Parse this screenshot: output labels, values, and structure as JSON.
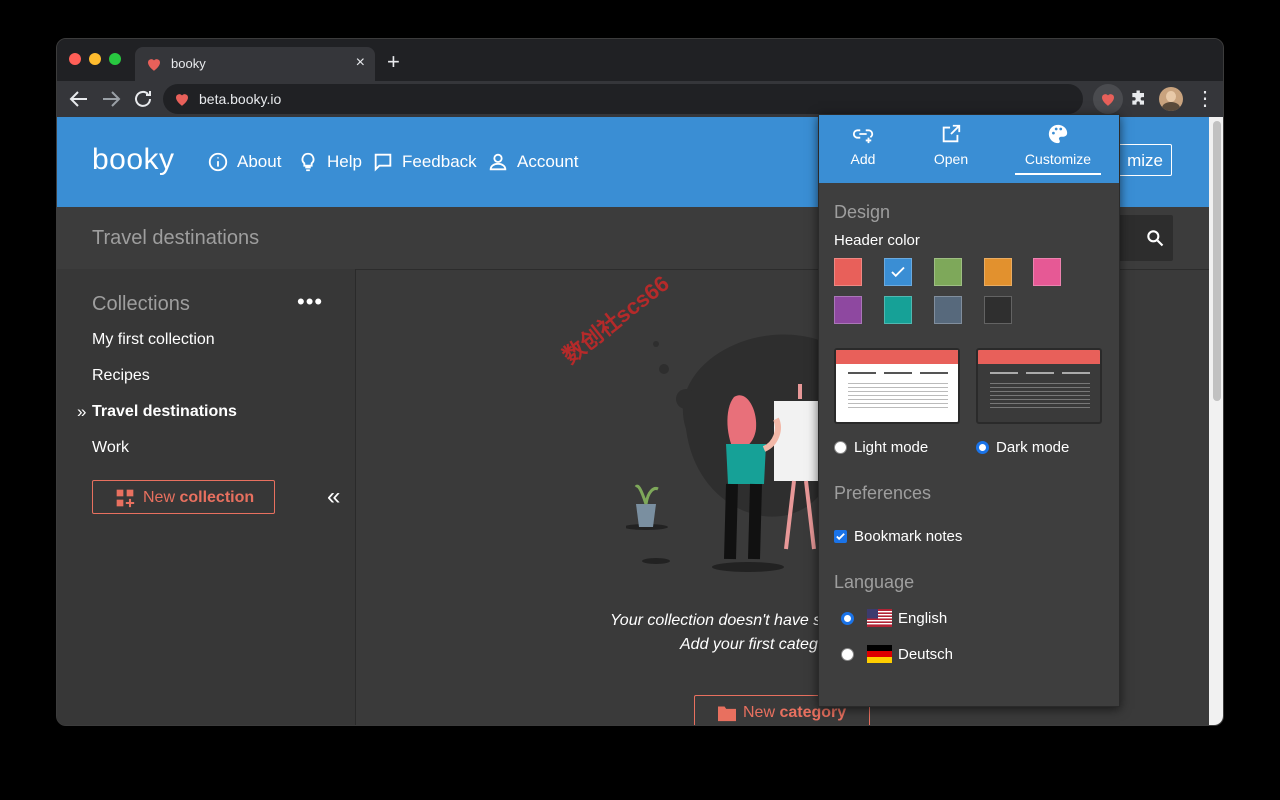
{
  "browser": {
    "tab_title": "booky",
    "new_tab_icon": "+",
    "close_tab_icon": "×",
    "url": "beta.booky.io"
  },
  "header": {
    "logo": "booky",
    "nav": [
      {
        "label": "About",
        "icon": "info-icon"
      },
      {
        "label": "Help",
        "icon": "lightbulb-icon"
      },
      {
        "label": "Feedback",
        "icon": "chat-icon"
      },
      {
        "label": "Account",
        "icon": "user-icon"
      }
    ],
    "customize_button": "mize",
    "color": "#3a8ed4"
  },
  "page": {
    "title": "Travel destinations"
  },
  "sidebar": {
    "title": "Collections",
    "more": "•••",
    "items": [
      {
        "label": "My first collection",
        "active": false
      },
      {
        "label": "Recipes",
        "active": false
      },
      {
        "label": "Travel destinations",
        "active": true
      },
      {
        "label": "Work",
        "active": false
      }
    ],
    "active_marker": "»",
    "new_collection": {
      "prefix": "New ",
      "bold": "collection"
    },
    "collapse": "«"
  },
  "main": {
    "empty_line1": "Your collection doesn't have s",
    "empty_line2": "Add your first categ",
    "new_category": {
      "prefix": "New ",
      "bold": "category"
    }
  },
  "watermark": "数创社scs66",
  "popup": {
    "tabs": [
      {
        "label": "Add",
        "icon": "link-add-icon"
      },
      {
        "label": "Open",
        "icon": "open-external-icon"
      },
      {
        "label": "Customize",
        "icon": "palette-icon",
        "active": true
      }
    ],
    "design_title": "Design",
    "header_color_label": "Header color",
    "swatches": [
      "#e8605a",
      "#3a8ed4",
      "#7ea85a",
      "#e2912e",
      "#e65995",
      "#8e48a0",
      "#16a197",
      "#57697c",
      "#2f2f2f"
    ],
    "selected_swatch": 1,
    "modes": [
      {
        "label": "Light mode",
        "checked": false
      },
      {
        "label": "Dark mode",
        "checked": true
      }
    ],
    "preferences_title": "Preferences",
    "bookmark_notes": {
      "label": "Bookmark notes",
      "checked": true
    },
    "language_title": "Language",
    "languages": [
      {
        "label": "English",
        "checked": true,
        "flag": "us-flag-icon"
      },
      {
        "label": "Deutsch",
        "checked": false,
        "flag": "de-flag-icon"
      }
    ]
  }
}
